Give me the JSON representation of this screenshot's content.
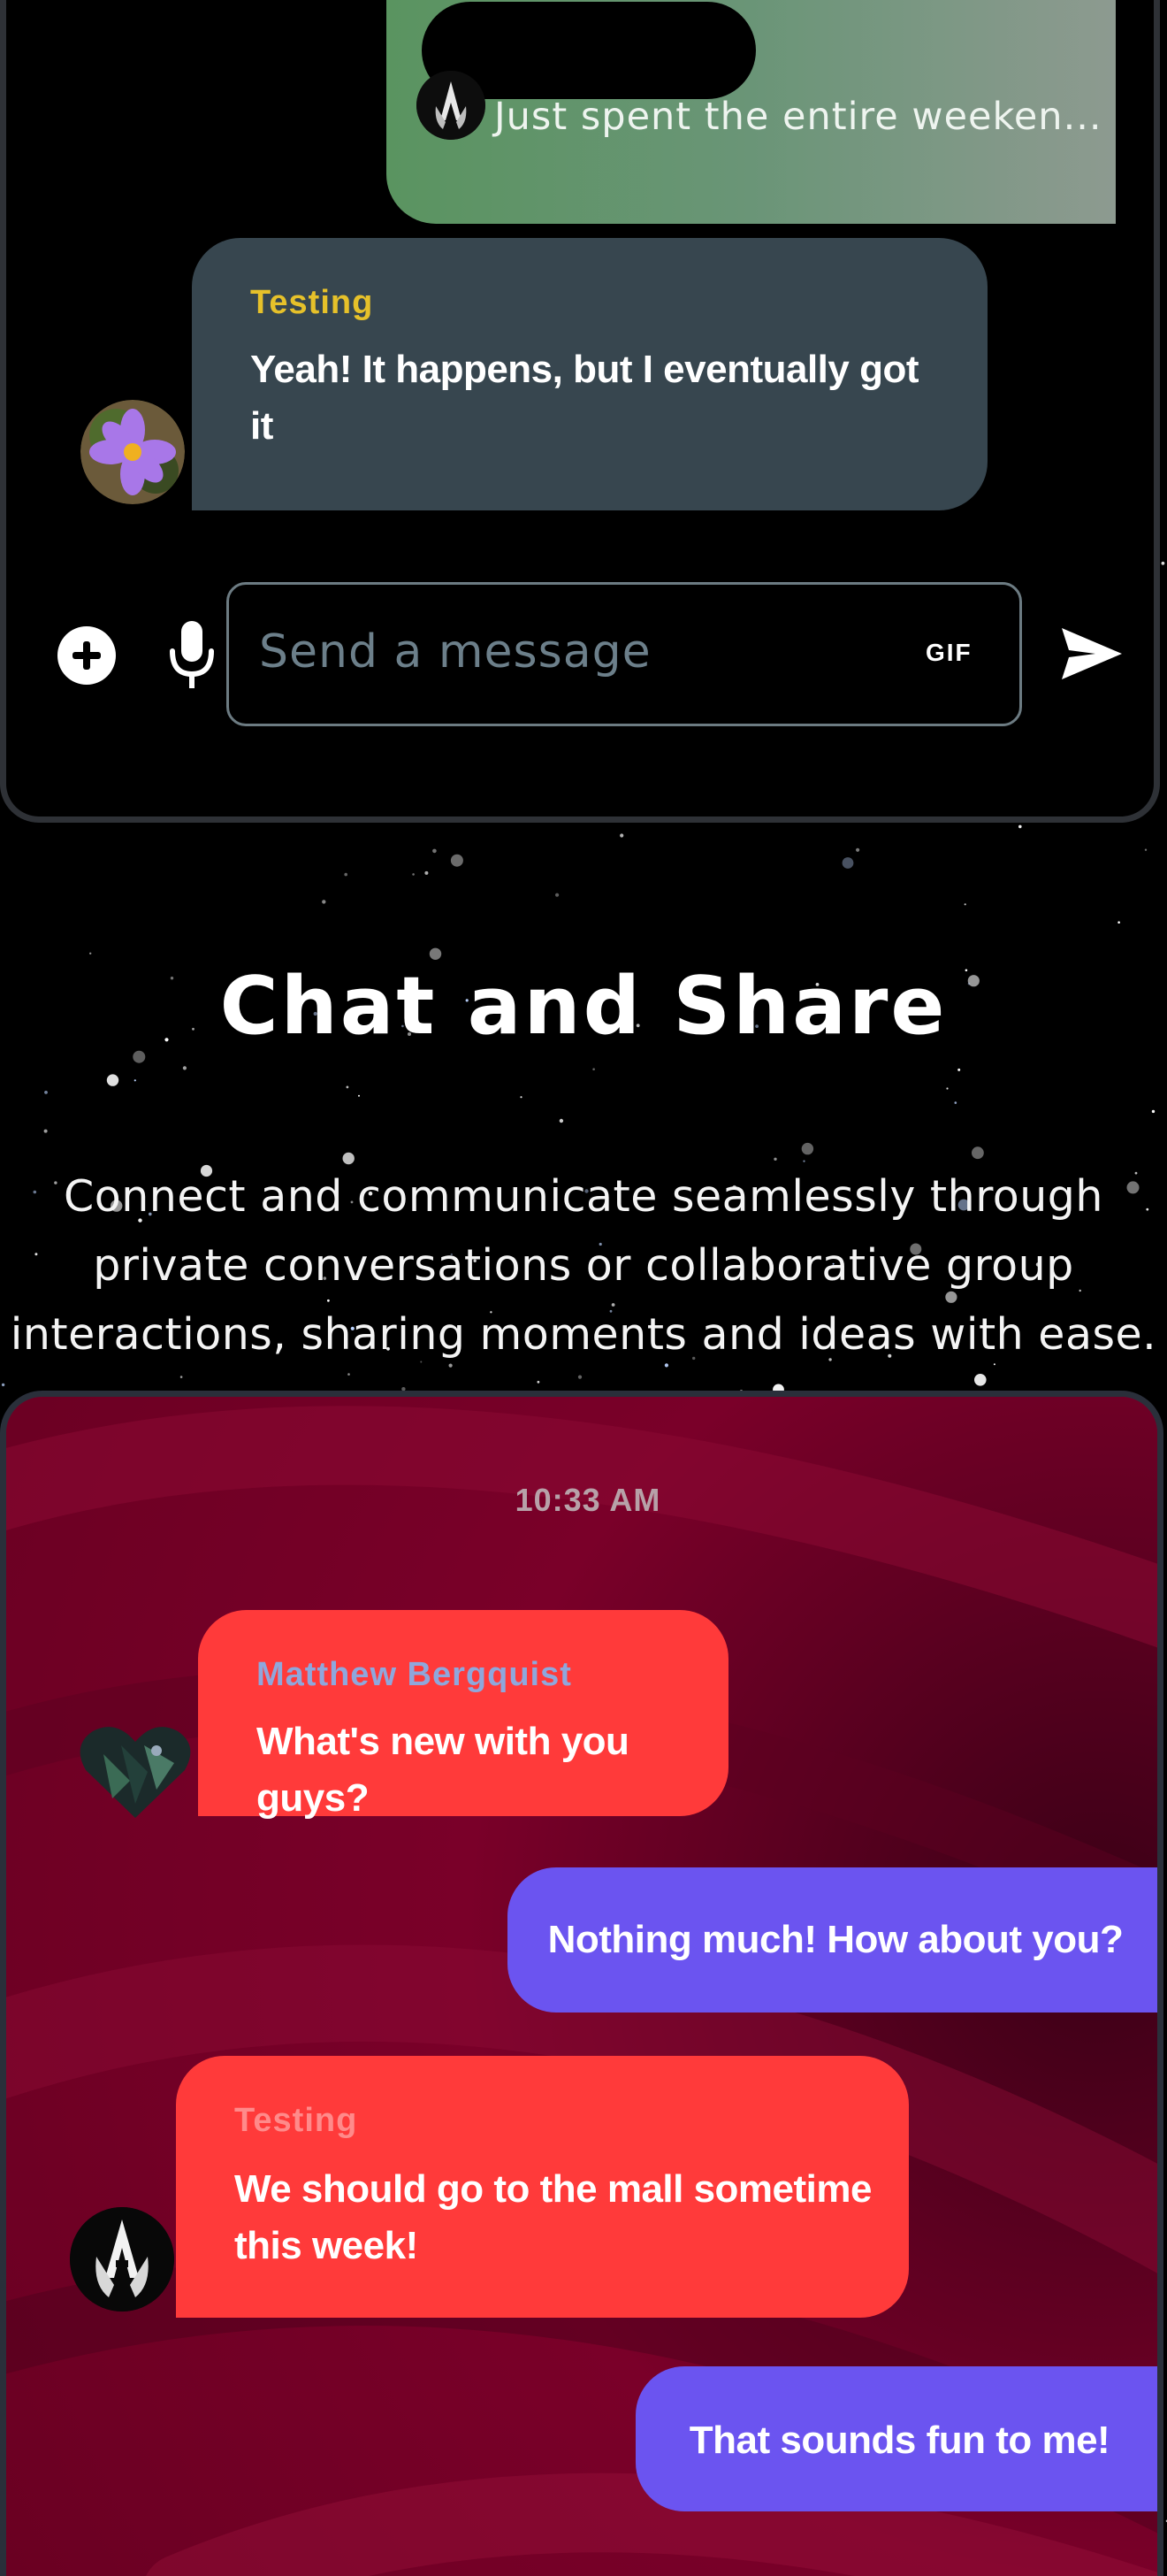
{
  "top_chat": {
    "shared_post_preview": "Just spent the entire weeken...",
    "messages": [
      {
        "sender": "Testing",
        "text": "Yeah! It happens, but I eventually got it"
      }
    ],
    "composer": {
      "placeholder": "Send a message",
      "gif_label": "GIF"
    }
  },
  "section": {
    "title": "Chat and Share",
    "description": "Connect and communicate seamlessly through private conversations or collaborative group interactions, sharing moments and ideas with ease."
  },
  "bottom_chat": {
    "timestamp": "10:33 AM",
    "messages": [
      {
        "sender": "Matthew Bergquist",
        "text": "What's new with you guys?"
      },
      {
        "text": "Nothing much! How about you?"
      },
      {
        "sender": "Testing",
        "text": "We should go to the mall sometime this week!"
      },
      {
        "text": "That sounds fun to me!"
      }
    ]
  },
  "icons": {
    "add": "plus-circle-icon",
    "mic": "microphone-icon",
    "gif": "gif-icon",
    "send": "send-icon"
  },
  "colors": {
    "page_bg": "#000000",
    "top_bubble": "#37464f",
    "sender_testing_top": "#e6c12a",
    "share_card_start": "#5a9460",
    "share_card_end": "#8d9a90",
    "bottom_bg": "#7a0029",
    "incoming_bubble": "#ff3a3a",
    "outgoing_bubble": "#6b54f0",
    "sender_matthew": "#8fa7dc",
    "sender_testing_bottom": "#ff8a8a"
  }
}
